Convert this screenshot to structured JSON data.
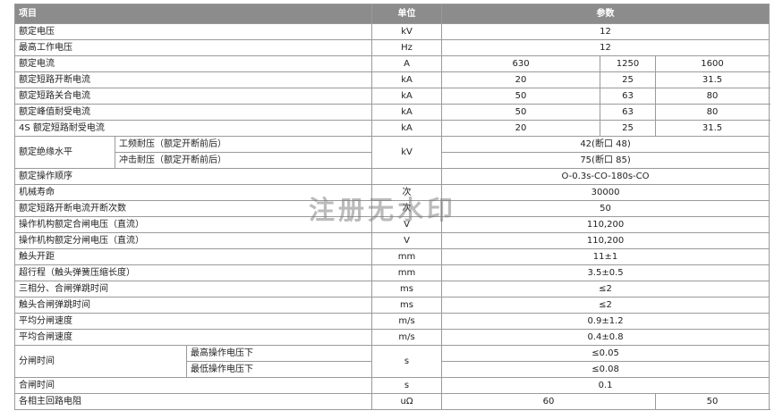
{
  "header": {
    "item": "项目",
    "unit": "单位",
    "param": "参数"
  },
  "rows": {
    "rated_voltage": {
      "label": "额定电压",
      "unit": "kV",
      "value": "12"
    },
    "max_voltage": {
      "label": "最高工作电压",
      "unit": "Hz",
      "value": "12"
    },
    "rated_current": {
      "label": "额定电流",
      "unit": "A",
      "values": [
        "630",
        "1250",
        "1600"
      ]
    },
    "short_break": {
      "label": "额定短路开断电流",
      "unit": "kA",
      "values": [
        "20",
        "25",
        "31.5"
      ]
    },
    "short_make": {
      "label": "额定短路关合电流",
      "unit": "kA",
      "values": [
        "50",
        "63",
        "80"
      ]
    },
    "peak_withstand": {
      "label": "额定峰值耐受电流",
      "unit": "kA",
      "values": [
        "50",
        "63",
        "80"
      ]
    },
    "short_time": {
      "label": "4S 额定短路耐受电流",
      "unit": "kA",
      "values": [
        "20",
        "25",
        "31.5"
      ]
    },
    "insulation": {
      "label": "额定绝缘水平",
      "unit": "kV",
      "power_freq_label": "工频耐压（额定开断前后）",
      "power_freq_value": "42(断口 48)",
      "impulse_label": "冲击耐压（额定开断前后）",
      "impulse_value": "75(断口 85)"
    },
    "sequence": {
      "label": "额定操作顺序",
      "unit": "",
      "value": "O-0.3s-CO-180s-CO"
    },
    "mech_life": {
      "label": "机械寿命",
      "unit": "次",
      "value": "30000"
    },
    "break_count": {
      "label": "额定短路开断电流开断次数",
      "unit": "次",
      "value": "50"
    },
    "close_voltage": {
      "label": "操作机构额定合闸电压（直流）",
      "unit": "V",
      "value": "110,200"
    },
    "open_voltage": {
      "label": "操作机构额定分闸电压（直流）",
      "unit": "V",
      "value": "110,200"
    },
    "contact_gap": {
      "label": "触头开距",
      "unit": "mm",
      "value": "11±1"
    },
    "overtravel": {
      "label": "超行程（触头弹簧压缩长度）",
      "unit": "mm",
      "value": "3.5±0.5"
    },
    "three_phase": {
      "label": "三相分、合闸弹跳时间",
      "unit": "ms",
      "value": "≤2"
    },
    "bounce": {
      "label": "触头合闸弹跳时间",
      "unit": "ms",
      "value": "≤2"
    },
    "avg_open_speed": {
      "label": "平均分闸速度",
      "unit": "m/s",
      "value": "0.9±1.2"
    },
    "avg_close_speed": {
      "label": "平均合闸速度",
      "unit": "m/s",
      "value": "0.4±0.8"
    },
    "open_time": {
      "label": "分闸时间",
      "unit": "s",
      "max_label": "最高操作电压下",
      "max_value": "≤0.05",
      "min_label": "最低操作电压下",
      "min_value": "≤0.08"
    },
    "close_time": {
      "label": "合闸时间",
      "unit": "s",
      "value": "0.1"
    },
    "resistance": {
      "label": "各相主回路电阻",
      "unit": "uΩ",
      "values": [
        "60",
        "50"
      ]
    }
  },
  "watermark": "注册无水印"
}
